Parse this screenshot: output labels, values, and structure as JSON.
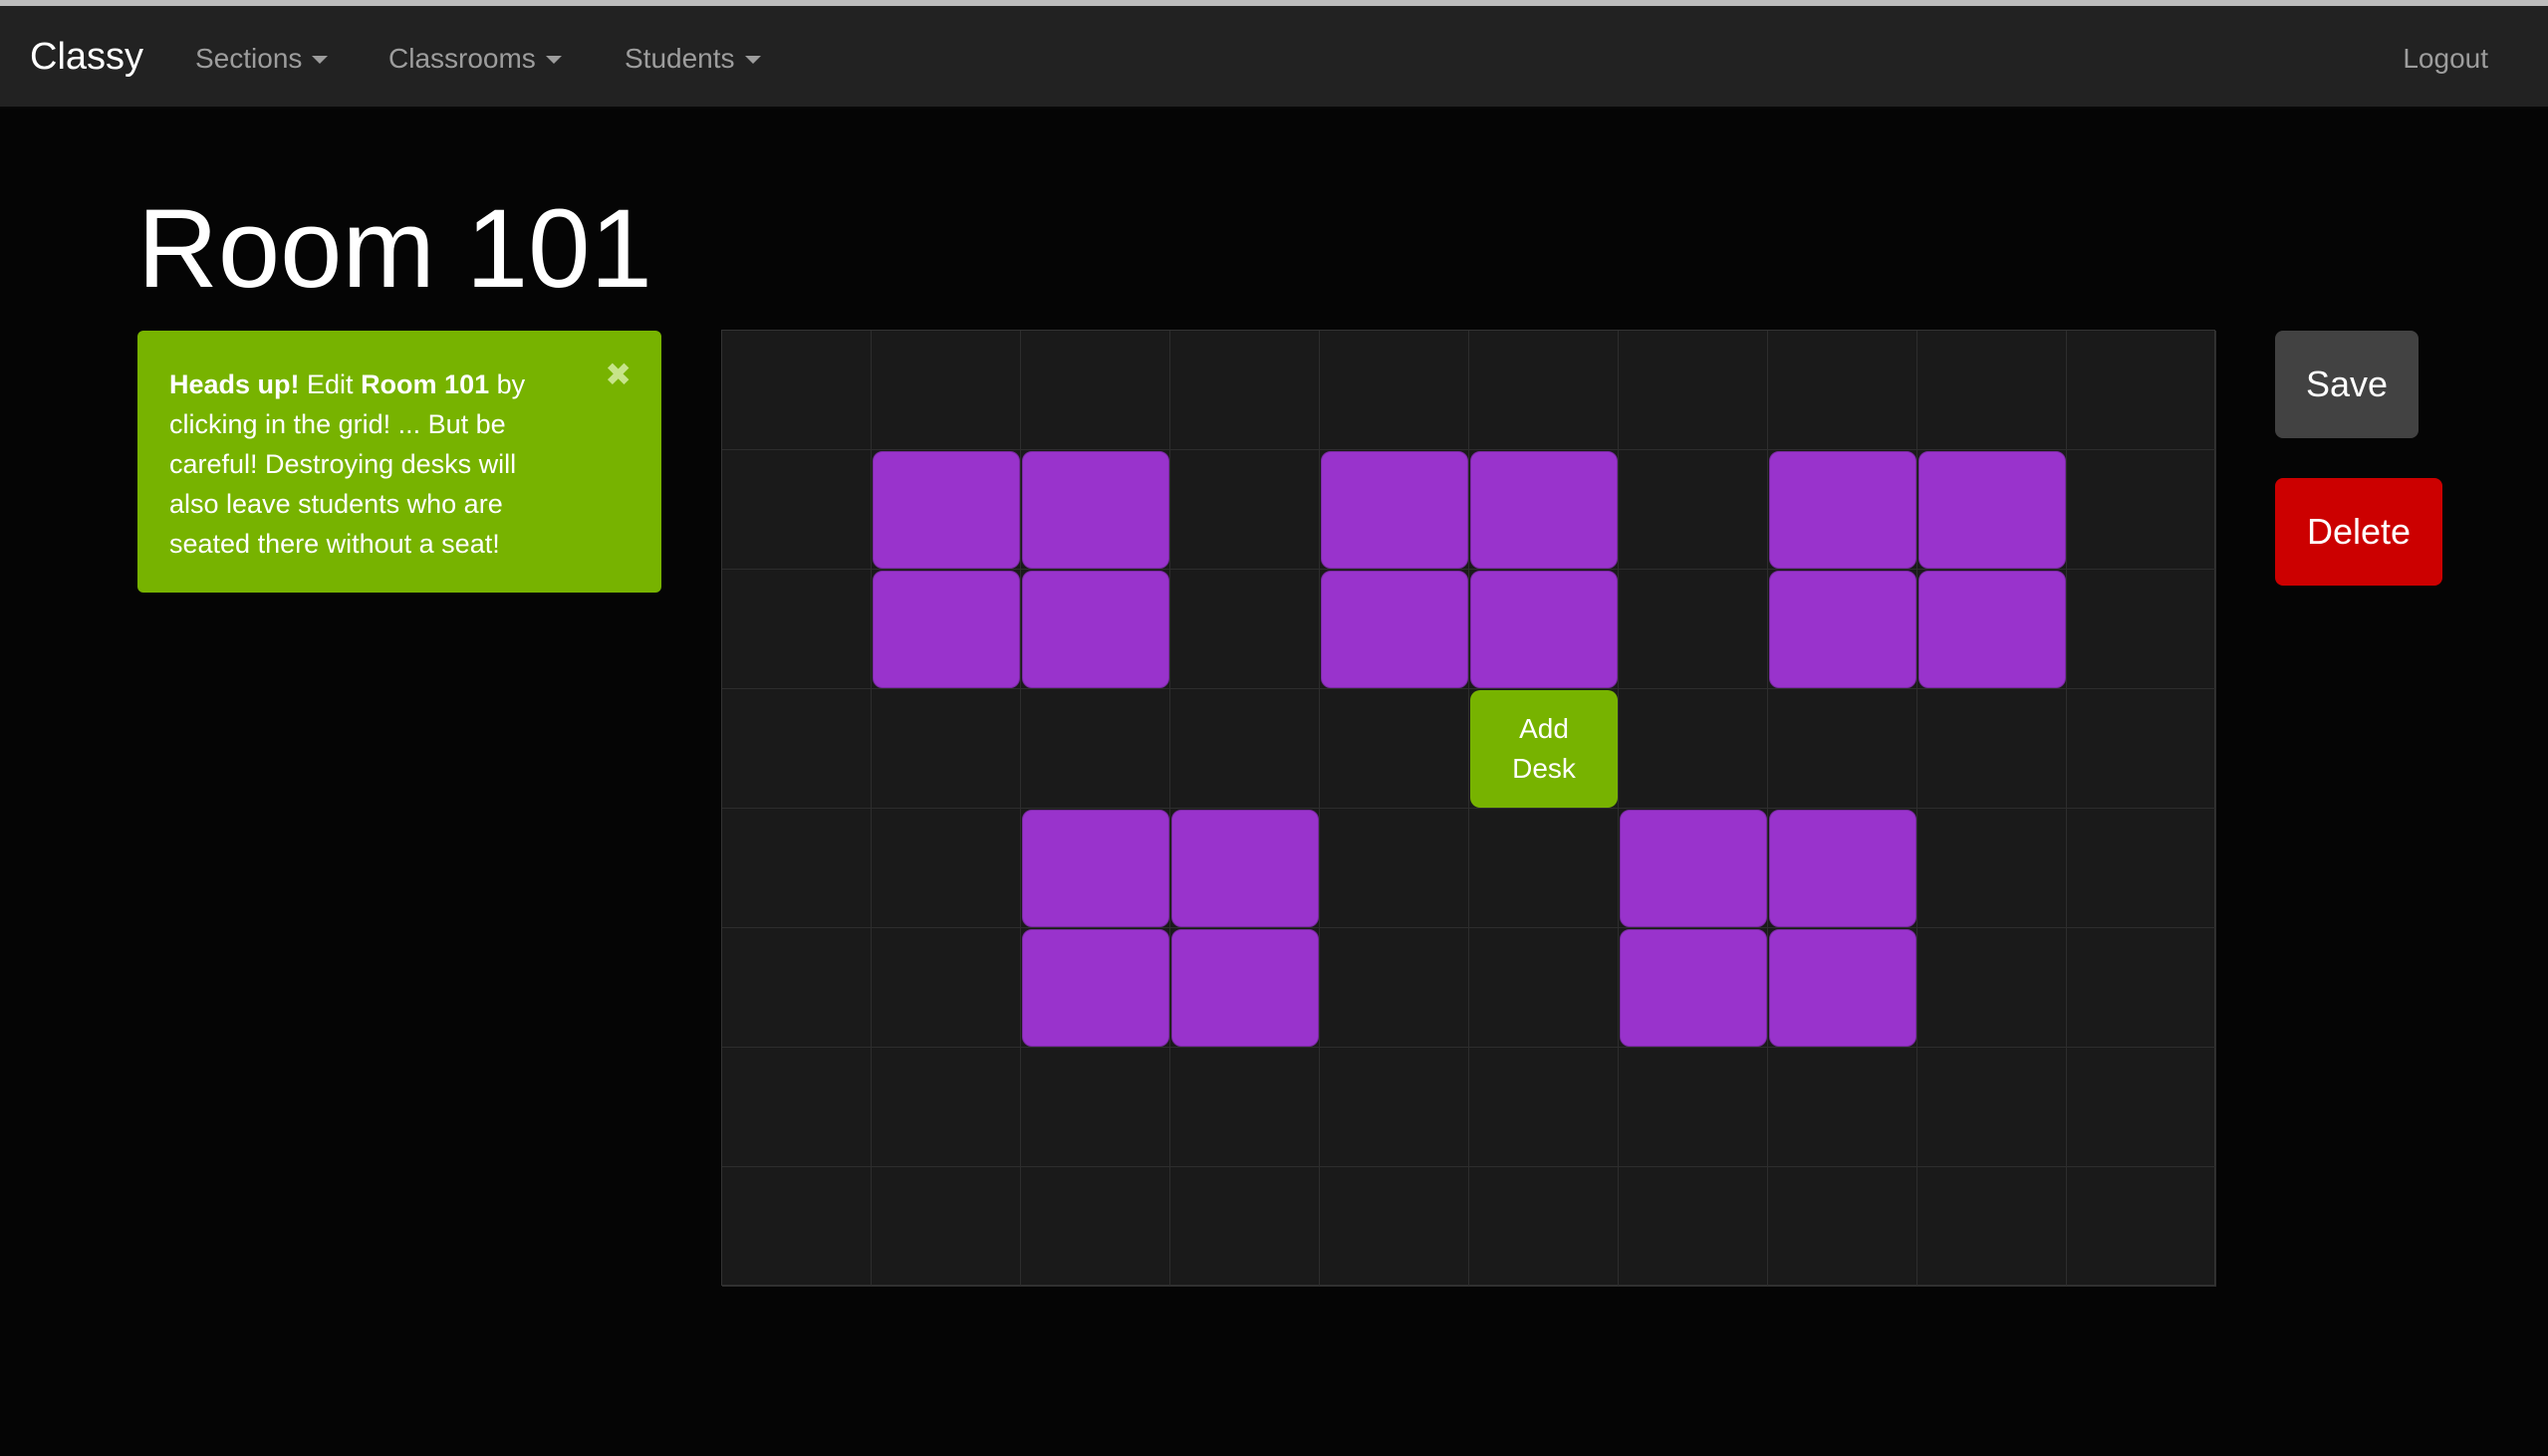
{
  "navbar": {
    "brand": "Classy",
    "items": [
      {
        "label": "Sections"
      },
      {
        "label": "Classrooms"
      },
      {
        "label": "Students"
      }
    ],
    "logout": "Logout"
  },
  "page": {
    "title": "Room 101"
  },
  "alert": {
    "strong_intro": "Heads up!",
    "text_1": " Edit ",
    "room_name": "Room 101",
    "text_2": " by clicking in the grid! ... But be careful! Destroying desks will also leave students who are seated there without a seat!",
    "close_glyph": "✖"
  },
  "grid": {
    "columns": 10,
    "rows": 8,
    "desks": [
      [
        1,
        1
      ],
      [
        1,
        2
      ],
      [
        1,
        4
      ],
      [
        1,
        5
      ],
      [
        1,
        7
      ],
      [
        1,
        8
      ],
      [
        2,
        1
      ],
      [
        2,
        2
      ],
      [
        2,
        4
      ],
      [
        2,
        5
      ],
      [
        2,
        7
      ],
      [
        2,
        8
      ],
      [
        4,
        2
      ],
      [
        4,
        3
      ],
      [
        4,
        6
      ],
      [
        4,
        7
      ],
      [
        5,
        2
      ],
      [
        5,
        3
      ],
      [
        5,
        6
      ],
      [
        5,
        7
      ]
    ],
    "add_desk": {
      "row": 3,
      "col": 5,
      "label": "Add Desk"
    }
  },
  "actions": {
    "save": "Save",
    "delete": "Delete"
  },
  "colors": {
    "desk": "#9933cc",
    "add_desk": "#77b300",
    "alert": "#77b300",
    "delete": "#cc0000",
    "save": "#424242"
  }
}
